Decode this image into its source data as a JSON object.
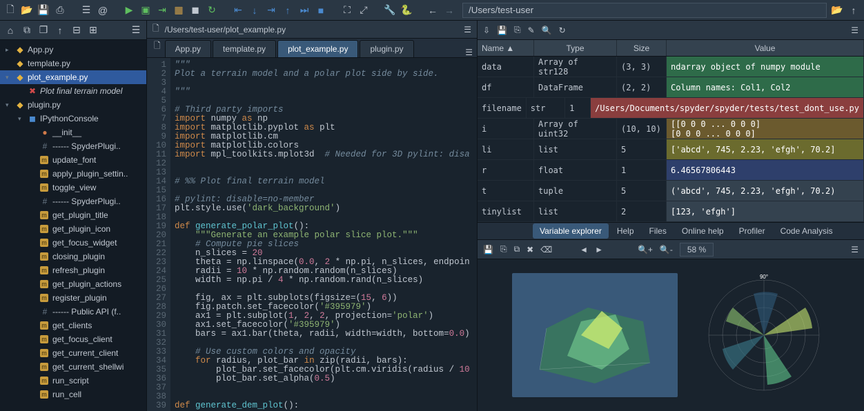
{
  "toolbar": {
    "path_input": "/Users/test-user"
  },
  "sidebar": {
    "items": [
      {
        "indent": 0,
        "tri": "▸",
        "ico": "py",
        "label": "App.py"
      },
      {
        "indent": 0,
        "tri": "",
        "ico": "py",
        "label": "template.py"
      },
      {
        "indent": 0,
        "tri": "▾",
        "ico": "py",
        "label": "plot_example.py",
        "sel": true
      },
      {
        "indent": 1,
        "tri": "",
        "ico": "x",
        "label": "Plot final terrain model",
        "italic": true
      },
      {
        "indent": 0,
        "tri": "▾",
        "ico": "py",
        "label": "plugin.py"
      },
      {
        "indent": 1,
        "tri": "▾",
        "ico": "c",
        "label": "IPythonConsole"
      },
      {
        "indent": 2,
        "tri": "",
        "ico": "o",
        "label": "__init__"
      },
      {
        "indent": 2,
        "tri": "",
        "ico": "#",
        "label": "------ SpyderPlugi.."
      },
      {
        "indent": 2,
        "tri": "",
        "ico": "m",
        "label": "update_font"
      },
      {
        "indent": 2,
        "tri": "",
        "ico": "m",
        "label": "apply_plugin_settin.."
      },
      {
        "indent": 2,
        "tri": "",
        "ico": "m",
        "label": "toggle_view"
      },
      {
        "indent": 2,
        "tri": "",
        "ico": "#",
        "label": "------ SpyderPlugi.."
      },
      {
        "indent": 2,
        "tri": "",
        "ico": "m",
        "label": "get_plugin_title"
      },
      {
        "indent": 2,
        "tri": "",
        "ico": "m",
        "label": "get_plugin_icon"
      },
      {
        "indent": 2,
        "tri": "",
        "ico": "m",
        "label": "get_focus_widget"
      },
      {
        "indent": 2,
        "tri": "",
        "ico": "m",
        "label": "closing_plugin"
      },
      {
        "indent": 2,
        "tri": "",
        "ico": "m",
        "label": "refresh_plugin"
      },
      {
        "indent": 2,
        "tri": "",
        "ico": "m",
        "label": "get_plugin_actions"
      },
      {
        "indent": 2,
        "tri": "",
        "ico": "m",
        "label": "register_plugin"
      },
      {
        "indent": 2,
        "tri": "",
        "ico": "#",
        "label": "------ Public API (f.."
      },
      {
        "indent": 2,
        "tri": "",
        "ico": "m",
        "label": "get_clients"
      },
      {
        "indent": 2,
        "tri": "",
        "ico": "m",
        "label": "get_focus_client"
      },
      {
        "indent": 2,
        "tri": "",
        "ico": "m",
        "label": "get_current_client"
      },
      {
        "indent": 2,
        "tri": "",
        "ico": "m",
        "label": "get_current_shellwi"
      },
      {
        "indent": 2,
        "tri": "",
        "ico": "m",
        "label": "run_script"
      },
      {
        "indent": 2,
        "tri": "",
        "ico": "m",
        "label": "run_cell"
      }
    ]
  },
  "editor": {
    "pathbar": "/Users/test-user/plot_example.py",
    "tabs": [
      {
        "label": "App.py"
      },
      {
        "label": "template.py"
      },
      {
        "label": "plot_example.py",
        "active": true
      },
      {
        "label": "plugin.py"
      }
    ],
    "code": [
      {
        "n": 1,
        "h": "<span class='c'>\"\"\"</span>"
      },
      {
        "n": 2,
        "h": "<span class='c'>Plot a terrain model and a polar plot side by side.</span>"
      },
      {
        "n": 3,
        "h": ""
      },
      {
        "n": 4,
        "h": "<span class='c'>\"\"\"</span>"
      },
      {
        "n": 5,
        "h": ""
      },
      {
        "n": 6,
        "h": "<span class='c'># Third party imports</span>"
      },
      {
        "n": 7,
        "h": "<span class='kw'>import</span> numpy <span class='kw'>as</span> np"
      },
      {
        "n": 8,
        "h": "<span class='kw'>import</span> matplotlib.pyplot <span class='kw'>as</span> plt"
      },
      {
        "n": 9,
        "h": "<span class='kw'>import</span> matplotlib.cm"
      },
      {
        "n": 10,
        "h": "<span class='kw'>import</span> matplotlib.colors"
      },
      {
        "n": 11,
        "h": "<span class='kw'>import</span> mpl_toolkits.mplot3d  <span class='c'># Needed for 3D pylint: disa</span>"
      },
      {
        "n": 12,
        "h": ""
      },
      {
        "n": 13,
        "h": ""
      },
      {
        "n": 14,
        "h": "<span class='c'># %% Plot final terrain model</span>"
      },
      {
        "n": 15,
        "h": ""
      },
      {
        "n": 16,
        "h": "<span class='c'># pylint: disable=no-member</span>"
      },
      {
        "n": 17,
        "h": "plt.style.use(<span class='str'>'dark_background'</span>)"
      },
      {
        "n": 18,
        "h": ""
      },
      {
        "n": 19,
        "h": "<span class='kw'>def</span> <span class='fn'>generate_polar_plot</span>():"
      },
      {
        "n": 20,
        "h": "    <span class='str'>\"\"\"Generate an example polar slice plot.\"\"\"</span>"
      },
      {
        "n": 21,
        "h": "    <span class='c'># Compute pie slices</span>"
      },
      {
        "n": 22,
        "h": "    n_slices = <span class='num'>20</span>"
      },
      {
        "n": 23,
        "h": "    theta = np.linspace(<span class='num'>0.0</span>, <span class='num'>2</span> * np.pi, n_slices, endpoin"
      },
      {
        "n": 24,
        "h": "    radii = <span class='num'>10</span> * np.random.random(n_slices)"
      },
      {
        "n": 25,
        "h": "    width = np.pi / <span class='num'>4</span> * np.random.rand(n_slices)"
      },
      {
        "n": 26,
        "h": ""
      },
      {
        "n": 27,
        "h": "    fig, ax = plt.subplots(figsize=(<span class='num'>15</span>, <span class='num'>6</span>))"
      },
      {
        "n": 28,
        "h": "    fig.patch.set_facecolor(<span class='str'>'#395979'</span>)"
      },
      {
        "n": 29,
        "h": "    ax1 = plt.subplot(<span class='num'>1</span>, <span class='num'>2</span>, <span class='num'>2</span>, projection=<span class='str'>'polar'</span>)"
      },
      {
        "n": 30,
        "h": "    ax1.set_facecolor(<span class='str'>'#395979'</span>)"
      },
      {
        "n": 31,
        "h": "    bars = ax1.bar(theta, radii, width=width, bottom=<span class='num'>0.0</span>)"
      },
      {
        "n": 32,
        "h": ""
      },
      {
        "n": 33,
        "h": "    <span class='c'># Use custom colors and opacity</span>"
      },
      {
        "n": 34,
        "h": "    <span class='kw'>for</span> radius, plot_bar <span class='kw'>in</span> zip(radii, bars):"
      },
      {
        "n": 35,
        "h": "        plot_bar.set_facecolor(plt.cm.viridis(radius / <span class='num'>10</span>"
      },
      {
        "n": 36,
        "h": "        plot_bar.set_alpha(<span class='num'>0.5</span>)"
      },
      {
        "n": 37,
        "h": ""
      },
      {
        "n": 38,
        "h": ""
      },
      {
        "n": 39,
        "h": "<span class='kw'>def</span> <span class='fn'>generate_dem_plot</span>():"
      }
    ]
  },
  "varexp": {
    "headers": {
      "name": "Name ▲",
      "type": "Type",
      "size": "Size",
      "value": "Value"
    },
    "rows": [
      {
        "name": "data",
        "type": "Array of str128",
        "size": "(3, 3)",
        "val": "ndarray object of numpy module",
        "bg": "#2e6b49"
      },
      {
        "name": "df",
        "type": "DataFrame",
        "size": "(2, 2)",
        "val": "Column names: Col1, Col2",
        "bg": "#2e6b49"
      },
      {
        "name": "filename",
        "type": "str",
        "size": "1",
        "val": "/Users/Documents/spyder/spyder/tests/test_dont_use.py",
        "bg": "#8a3e3e"
      },
      {
        "name": "i",
        "type": "Array of uint32",
        "size": "(10, 10)",
        "val": "[[0 0 0 ... 0 0 0]\n [0 0 0 ... 0 0 0]",
        "bg": "#6b5a2e"
      },
      {
        "name": "li",
        "type": "list",
        "size": "5",
        "val": "['abcd', 745, 2.23, 'efgh', 70.2]",
        "bg": "#6b6b2e"
      },
      {
        "name": "r",
        "type": "float",
        "size": "1",
        "val": "6.46567806443",
        "bg": "#2e3f6b"
      },
      {
        "name": "t",
        "type": "tuple",
        "size": "5",
        "val": "('abcd', 745, 2.23, 'efgh', 70.2)",
        "bg": "#34424f"
      },
      {
        "name": "tinylist",
        "type": "list",
        "size": "2",
        "val": "[123, 'efgh']",
        "bg": "#34424f"
      }
    ],
    "bottabs": [
      {
        "label": "Variable explorer",
        "active": true
      },
      {
        "label": "Help"
      },
      {
        "label": "Files"
      },
      {
        "label": "Online help"
      },
      {
        "label": "Profiler"
      },
      {
        "label": "Code Analysis"
      }
    ],
    "zoom": "58 %"
  }
}
